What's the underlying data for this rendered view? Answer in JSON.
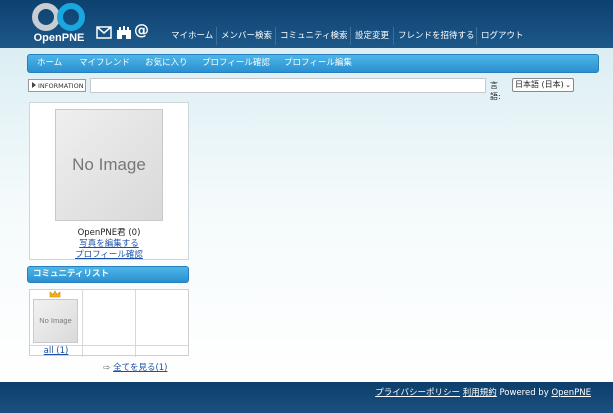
{
  "brand": {
    "name": "OpenPNE"
  },
  "header_icons": [
    "mail-icon",
    "castle-icon",
    "at-icon"
  ],
  "global_nav": [
    "マイホーム",
    "メンバー検索",
    "コミュニティ検索",
    "設定変更",
    "フレンドを招待する",
    "ログアウト"
  ],
  "local_nav": [
    "ホーム",
    "マイフレンド",
    "お気に入り",
    "プロフィール確認",
    "プロフィール編集"
  ],
  "information": {
    "label": "INFORMATION"
  },
  "language": {
    "label": "言語:",
    "selected": "日本語 (日本)"
  },
  "profile": {
    "photo_placeholder": "No Image",
    "name": "OpenPNE君 (0)",
    "edit_photo": "写真を編集する",
    "view_profile": "プロフィール確認"
  },
  "community_list": {
    "title": "コミュニティリスト",
    "items": [
      {
        "name": "all (1)",
        "thumb": "No Image",
        "is_admin": true
      }
    ],
    "see_all": "全てを見る(1)"
  },
  "footer": {
    "privacy": "プライバシーポリシー",
    "terms": "利用規約",
    "powered_by": "Powered by",
    "powered_link": "OpenPNE"
  },
  "colors": {
    "header": "#0c4170",
    "nav_blue": "#2c8fd0",
    "link": "#1a50a8"
  }
}
